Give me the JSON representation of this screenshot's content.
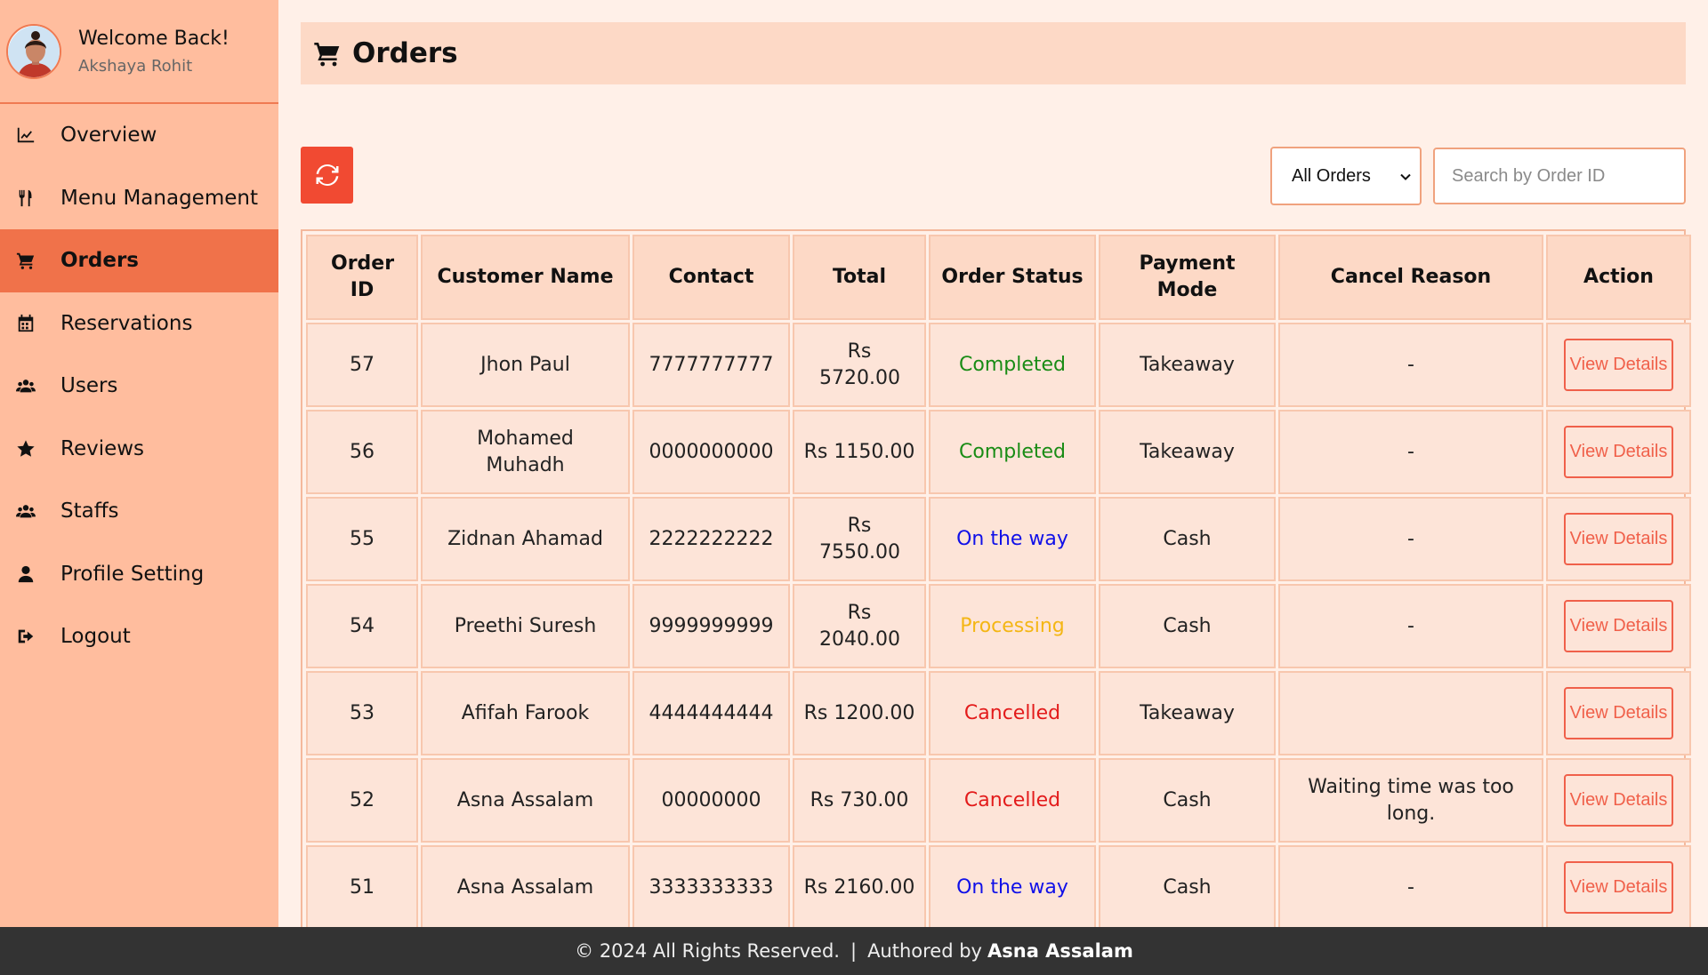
{
  "sidebar": {
    "welcome": "Welcome Back!",
    "user_name": "Akshaya Rohit",
    "items": [
      {
        "label": "Overview",
        "icon": "chart-line-icon"
      },
      {
        "label": "Menu Management",
        "icon": "utensils-icon"
      },
      {
        "label": "Orders",
        "icon": "cart-icon",
        "active": true
      },
      {
        "label": "Reservations",
        "icon": "calendar-icon"
      },
      {
        "label": "Users",
        "icon": "users-icon"
      },
      {
        "label": "Reviews",
        "icon": "star-icon"
      },
      {
        "label": "Staffs",
        "icon": "users-icon"
      },
      {
        "label": "Profile Setting",
        "icon": "user-icon"
      },
      {
        "label": "Logout",
        "icon": "logout-icon"
      }
    ]
  },
  "header": {
    "title": "Orders",
    "icon": "cart-icon"
  },
  "toolbar": {
    "refresh_icon": "refresh-icon",
    "filter_value": "All Orders",
    "search_placeholder": "Search by Order ID"
  },
  "table": {
    "columns": [
      "Order ID",
      "Customer Name",
      "Contact",
      "Total",
      "Order Status",
      "Payment Mode",
      "Cancel Reason",
      "Action"
    ],
    "rows": [
      {
        "id": "57",
        "name": "Jhon Paul",
        "contact": "7777777777",
        "total": "Rs 5720.00",
        "status": "Completed",
        "payment": "Takeaway",
        "reason": "-",
        "action": "View Details"
      },
      {
        "id": "56",
        "name": "Mohamed Muhadh",
        "contact": "0000000000",
        "total": "Rs 1150.00",
        "status": "Completed",
        "payment": "Takeaway",
        "reason": "-",
        "action": "View Details"
      },
      {
        "id": "55",
        "name": "Zidnan Ahamad",
        "contact": "2222222222",
        "total": "Rs 7550.00",
        "status": "On the way",
        "payment": "Cash",
        "reason": "-",
        "action": "View Details"
      },
      {
        "id": "54",
        "name": "Preethi Suresh",
        "contact": "9999999999",
        "total": "Rs 2040.00",
        "status": "Processing",
        "payment": "Cash",
        "reason": "-",
        "action": "View Details"
      },
      {
        "id": "53",
        "name": "Afifah Farook",
        "contact": "4444444444",
        "total": "Rs 1200.00",
        "status": "Cancelled",
        "payment": "Takeaway",
        "reason": "",
        "action": "View Details"
      },
      {
        "id": "52",
        "name": "Asna Assalam",
        "contact": "00000000",
        "total": "Rs 730.00",
        "status": "Cancelled",
        "payment": "Cash",
        "reason": "Waiting time was too long.",
        "action": "View Details"
      },
      {
        "id": "51",
        "name": "Asna Assalam",
        "contact": "3333333333",
        "total": "Rs 2160.00",
        "status": "On the way",
        "payment": "Cash",
        "reason": "-",
        "action": "View Details"
      }
    ]
  },
  "colors": {
    "sidebar_bg": "#ffbd9e",
    "active_bg": "#f0724a",
    "completed": "#198c15",
    "on_the_way": "#1010e8",
    "processing": "#f4b614",
    "cancelled": "#e31b1b"
  },
  "footer": {
    "copyright": "© 2024 All Rights Reserved.",
    "separator": "|",
    "authored_by": "Authored by",
    "author": "Asna Assalam"
  }
}
